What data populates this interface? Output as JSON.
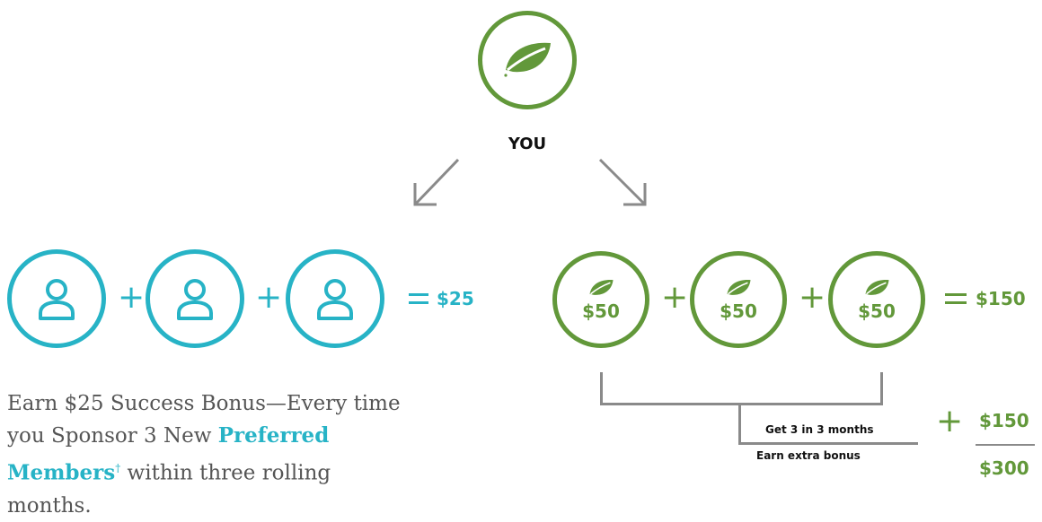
{
  "top": {
    "label": "YOU"
  },
  "left_group": {
    "members": [
      {
        "icon": "person-icon"
      },
      {
        "icon": "person-icon"
      },
      {
        "icon": "person-icon"
      }
    ],
    "plus": "+",
    "result": "$25"
  },
  "right_group": {
    "members": [
      {
        "amount": "$50"
      },
      {
        "amount": "$50"
      },
      {
        "amount": "$50"
      }
    ],
    "plus": "+",
    "result": "$150"
  },
  "bonus": {
    "line1": "Get 3 in 3 months",
    "line2": "Earn extra bonus",
    "plus": "+",
    "extra": "$150",
    "total": "$300"
  },
  "caption": {
    "part1": "Earn $25 Success Bonus—Every time you Sponsor 3 New ",
    "highlight": "Preferred Members",
    "dagger": "†",
    "part2": " within three rolling months."
  },
  "colors": {
    "teal": "#27b3c6",
    "green": "#62983a",
    "gray": "#8a8a8a"
  }
}
